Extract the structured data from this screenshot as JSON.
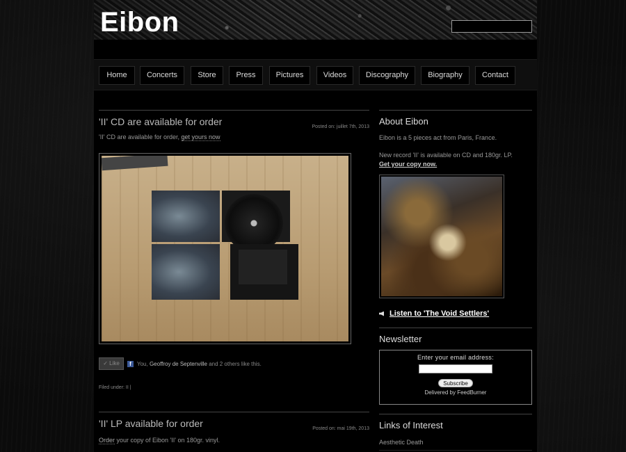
{
  "site": {
    "title": "Eibon",
    "search_placeholder": ""
  },
  "nav": {
    "items": [
      "Home",
      "Concerts",
      "Store",
      "Press",
      "Pictures",
      "Videos",
      "Discography",
      "Biography",
      "Contact"
    ]
  },
  "posts": [
    {
      "title": "'II' CD are available for order",
      "date": "Posted on: juillet 7th, 2013",
      "excerpt_prefix": "'II' CD are available for order, ",
      "excerpt_link": "get yours now",
      "like_label": "✓ Like",
      "fb_you": "You, ",
      "fb_name": "Geoffroy de Septenville",
      "fb_rest": " and 2 others like this.",
      "filed_under": "Filed under: II |"
    },
    {
      "title": "'II' LP available for order",
      "date": "Posted on: mai 19th, 2013",
      "excerpt_link": "Order",
      "excerpt_suffix": " your copy of Eibon 'II' on 180gr. vinyl."
    }
  ],
  "sidebar": {
    "about_title": "About Eibon",
    "about_text": "Eibon is a 5 pieces act from Paris, France.",
    "record_text": "New record 'II' is available on CD and 180gr. LP.",
    "record_link": "Get your copy now.",
    "listen_link": "Listen to 'The Void Settlers'",
    "newsletter_title": "Newsletter",
    "newsletter_label": "Enter your email address:",
    "subscribe_label": "Subscribe",
    "delivered": "Delivered by FeedBurner",
    "links_title": "Links of Interest",
    "links": [
      "Aesthetic Death"
    ]
  }
}
